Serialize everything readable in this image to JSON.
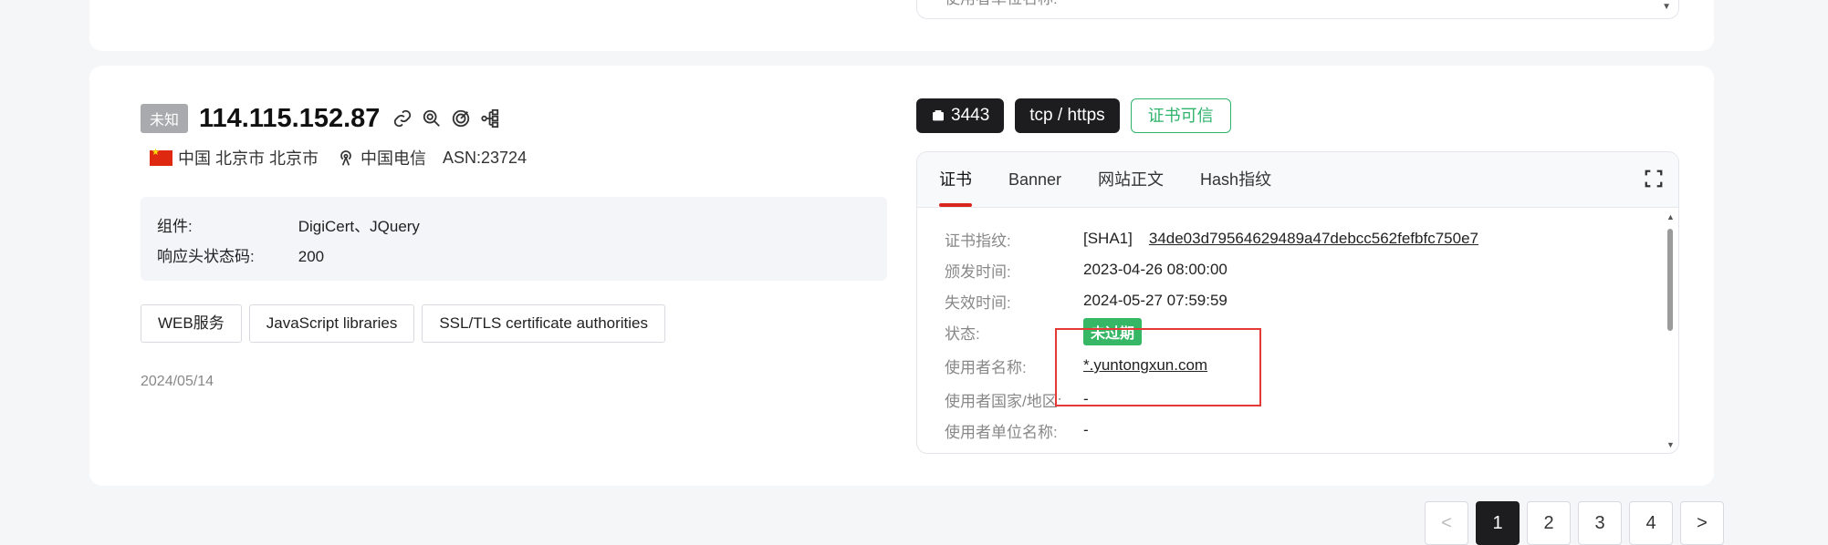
{
  "previous_card": {
    "label": "使用者单位名称:",
    "value": "-"
  },
  "host": {
    "status_tag": "未知",
    "ip": "114.115.152.87",
    "location": "中国 北京市 北京市",
    "isp": "中国电信",
    "asn": "ASN:23724",
    "info": [
      {
        "label": "组件:",
        "value": "DigiCert、JQuery"
      },
      {
        "label": "响应头状态码:",
        "value": "200"
      }
    ],
    "chips": [
      "WEB服务",
      "JavaScript libraries",
      "SSL/TLS certificate authorities"
    ],
    "date": "2024/05/14"
  },
  "service": {
    "port": "3443",
    "protocol": "tcp / https",
    "cert_trust": "证书可信"
  },
  "tabs": [
    "证书",
    "Banner",
    "网站正文",
    "Hash指纹"
  ],
  "cert": {
    "fingerprint_label": "证书指纹:",
    "sha_prefix": "[SHA1]",
    "fingerprint": "34de03d79564629489a47debcc562fefbfc750e7",
    "issued_label": "颁发时间:",
    "issued": "2023-04-26 08:00:00",
    "expires_label": "失效时间:",
    "expires": "2024-05-27 07:59:59",
    "status_label": "状态:",
    "status": "未过期",
    "subject_name_label": "使用者名称:",
    "subject_name": "*.yuntongxun.com",
    "subject_country_label": "使用者国家/地区:",
    "subject_country": "-",
    "subject_org_label": "使用者单位名称:",
    "subject_org": "-"
  },
  "pagination": {
    "pages": [
      "1",
      "2",
      "3",
      "4"
    ],
    "prev": "<",
    "next": ">",
    "current": "1"
  },
  "colors": {
    "accent_red": "#d9261c",
    "green": "#36b766",
    "dark": "#1d1d1f"
  }
}
